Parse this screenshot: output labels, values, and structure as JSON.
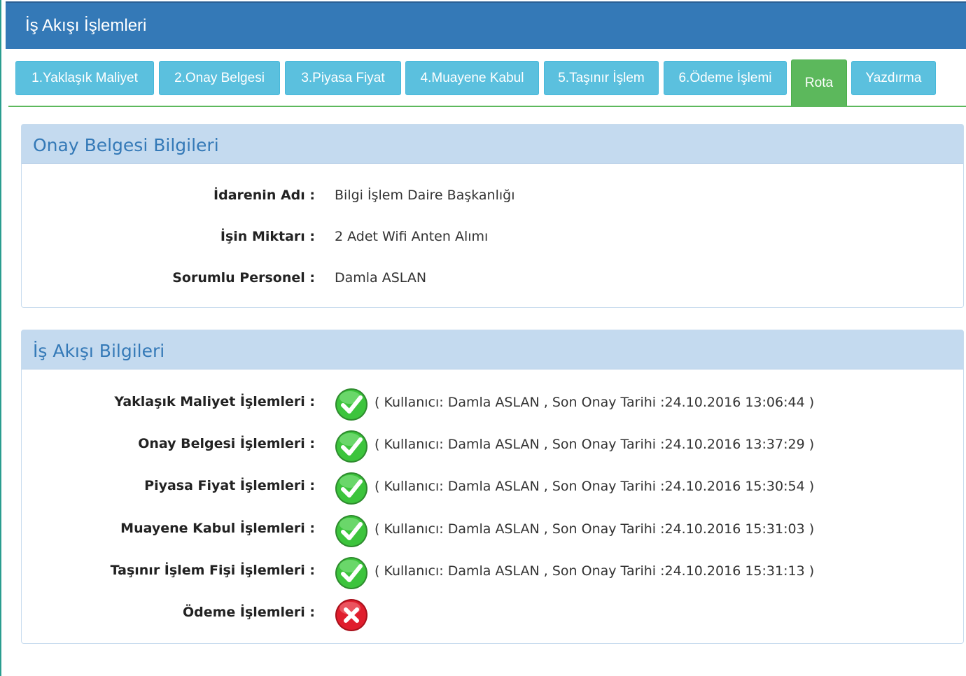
{
  "header": {
    "title": "İş Akışı İşlemleri"
  },
  "tabs": [
    {
      "label": "1.Yaklaşık Maliyet"
    },
    {
      "label": "2.Onay Belgesi"
    },
    {
      "label": "3.Piyasa Fiyat"
    },
    {
      "label": "4.Muayene Kabul"
    },
    {
      "label": "5.Taşınır İşlem"
    },
    {
      "label": "6.Ödeme İşlemi"
    },
    {
      "label": "Rota",
      "active": true
    },
    {
      "label": "Yazdırma"
    }
  ],
  "approval_panel": {
    "title": "Onay Belgesi Bilgileri",
    "rows": [
      {
        "label": "İdarenin Adı :",
        "value": "Bilgi İşlem Daire Başkanlığı"
      },
      {
        "label": "İşin Miktarı :",
        "value": "2 Adet Wifi Anten Alımı"
      },
      {
        "label": "Sorumlu Personel :",
        "value": "Damla ASLAN"
      }
    ]
  },
  "workflow_panel": {
    "title": "İş Akışı Bilgileri",
    "rows": [
      {
        "label": "Yaklaşık Maliyet İşlemleri :",
        "status": "done",
        "info": "( Kullanıcı: Damla ASLAN , Son Onay Tarihi :24.10.2016 13:06:44 )"
      },
      {
        "label": "Onay Belgesi İşlemleri :",
        "status": "done",
        "info": "( Kullanıcı: Damla ASLAN , Son Onay Tarihi :24.10.2016 13:37:29 )"
      },
      {
        "label": "Piyasa Fiyat İşlemleri :",
        "status": "done",
        "info": "( Kullanıcı: Damla ASLAN , Son Onay Tarihi :24.10.2016 15:30:54 )"
      },
      {
        "label": "Muayene Kabul İşlemleri :",
        "status": "done",
        "info": "( Kullanıcı: Damla ASLAN , Son Onay Tarihi :24.10.2016 15:31:03 )"
      },
      {
        "label": "Taşınır İşlem Fişi İşlemleri :",
        "status": "done",
        "info": "( Kullanıcı: Damla ASLAN , Son Onay Tarihi :24.10.2016 15:31:13 )"
      },
      {
        "label": "Ödeme İşlemleri :",
        "status": "pending",
        "info": ""
      }
    ]
  },
  "icons": {
    "done": "check-circle-icon",
    "pending": "cross-circle-icon"
  },
  "colors": {
    "header_bg": "#3479b7",
    "tab_bg": "#5bc0de",
    "tab_active_bg": "#5cb85c",
    "panel_head_bg": "#c4daef",
    "panel_title": "#3479b7",
    "check_green": "#3cc43c",
    "cross_red": "#e01e2d"
  }
}
